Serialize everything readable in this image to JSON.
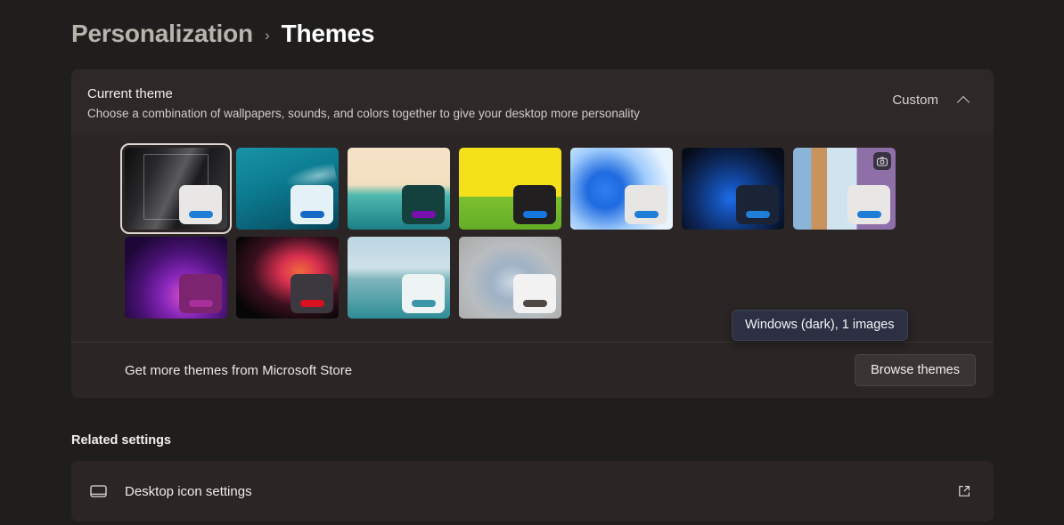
{
  "breadcrumb": {
    "parent": "Personalization",
    "separator": "›",
    "current": "Themes"
  },
  "current_theme": {
    "title": "Current theme",
    "description": "Choose a combination of wallpapers, sounds, and colors together to give your desktop more personality",
    "value": "Custom",
    "collapse_icon": "chevron-up-icon",
    "themes": [
      {
        "name": "dark-hall",
        "bg_class": "bg-dark-hall",
        "window": "#e9e7e6",
        "accent": "#1f7ed8",
        "selected": true,
        "badge": ""
      },
      {
        "name": "ocean",
        "bg_class": "bg-ocean",
        "window": "#e4f2f7",
        "accent": "#1769c8",
        "selected": false,
        "badge": ""
      },
      {
        "name": "tropical",
        "bg_class": "bg-tropical",
        "window": "#14403e",
        "accent": "#7a0fb0",
        "selected": false,
        "badge": ""
      },
      {
        "name": "retro",
        "bg_class": "bg-retro",
        "window": "#221f21",
        "accent": "#1478e0",
        "selected": false,
        "badge": ""
      },
      {
        "name": "windows-light",
        "bg_class": "bg-win-light",
        "window": "#e8e6e4",
        "accent": "#1f7ed8",
        "selected": false,
        "badge": ""
      },
      {
        "name": "windows-dark",
        "bg_class": "bg-win-dark",
        "window": "#1b2436",
        "accent": "#1f7ed8",
        "selected": false,
        "badge": ""
      },
      {
        "name": "spotlight",
        "bg_class": "bg-spotlight",
        "window": "#e9e7e6",
        "accent": "#1f7ed8",
        "selected": false,
        "badge": "camera-icon"
      },
      {
        "name": "purple-glow",
        "bg_class": "bg-purple-glow",
        "window": "#7c2470",
        "accent": "#a7309c",
        "selected": false,
        "badge": ""
      },
      {
        "name": "flower",
        "bg_class": "bg-flower",
        "window": "#3b3840",
        "accent": "#d81020",
        "selected": false,
        "badge": ""
      },
      {
        "name": "lake",
        "bg_class": "bg-lake",
        "window": "#eef3f4",
        "accent": "#3d95a8",
        "selected": false,
        "badge": ""
      },
      {
        "name": "fabric",
        "bg_class": "bg-fabric",
        "window": "#f2f2f2",
        "accent": "#4b4846",
        "selected": false,
        "badge": ""
      }
    ],
    "tooltip": "Windows (dark), 1 images",
    "store_label": "Get more themes from Microsoft Store",
    "browse_button": "Browse themes"
  },
  "related_settings": {
    "title": "Related settings",
    "items": [
      {
        "label": "Desktop icon settings",
        "icon": "monitor-icon",
        "action_icon": "external-link-icon"
      }
    ]
  },
  "colors": {
    "page_bg": "#201e1c",
    "card_bg": "#2b2625",
    "card_header_bg": "#2e2928",
    "tooltip_bg": "#2c3042",
    "accent_blue": "#1f7ed8"
  }
}
